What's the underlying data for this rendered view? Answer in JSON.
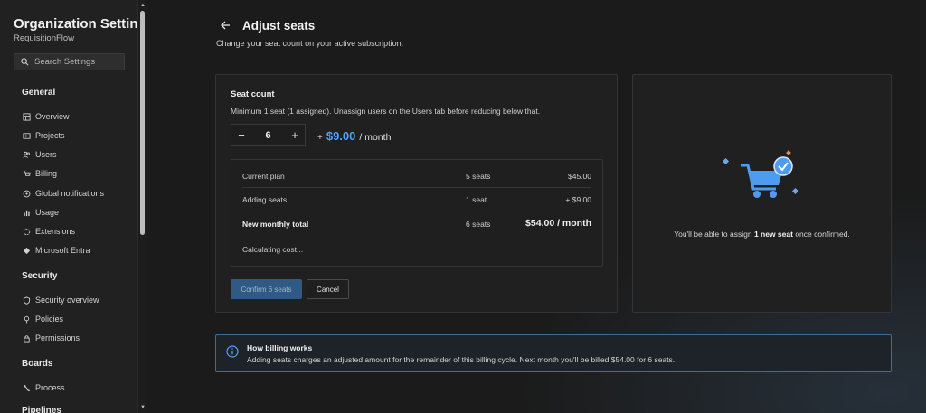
{
  "sidebar": {
    "title": "Organization Settin...",
    "org_name": "RequisitionFlow",
    "search_placeholder": "Search Settings",
    "groups": [
      {
        "label": "General",
        "items": [
          {
            "label": "Overview",
            "icon": "overview-icon"
          },
          {
            "label": "Projects",
            "icon": "projects-icon"
          },
          {
            "label": "Users",
            "icon": "users-icon"
          },
          {
            "label": "Billing",
            "icon": "billing-icon"
          },
          {
            "label": "Global notifications",
            "icon": "notifications-icon"
          },
          {
            "label": "Usage",
            "icon": "usage-icon"
          },
          {
            "label": "Extensions",
            "icon": "extensions-icon"
          },
          {
            "label": "Microsoft Entra",
            "icon": "entra-icon"
          }
        ]
      },
      {
        "label": "Security",
        "items": [
          {
            "label": "Security overview",
            "icon": "shield-icon"
          },
          {
            "label": "Policies",
            "icon": "policies-icon"
          },
          {
            "label": "Permissions",
            "icon": "lock-icon"
          }
        ]
      },
      {
        "label": "Boards",
        "items": [
          {
            "label": "Process",
            "icon": "process-icon"
          }
        ]
      },
      {
        "label": "Pipelines",
        "items": []
      }
    ]
  },
  "header": {
    "back_icon": "arrow-left-icon",
    "title": "Adjust seats",
    "subtitle": "Change your seat count on your active subscription."
  },
  "seat_card": {
    "title": "Seat count",
    "description": "Minimum 1 seat (1 assigned). Unassign users on the Users tab before reducing below that.",
    "decrement": "−",
    "value": "6",
    "increment": "+",
    "price_prefix": "+",
    "price": "$9.00",
    "price_period": "/ month",
    "summary": {
      "rows": [
        {
          "label": "Current plan",
          "seats": "5 seats",
          "amount": "$45.00"
        },
        {
          "label": "Adding seats",
          "seats": "1 seat",
          "amount": "+ $9.00"
        }
      ],
      "total": {
        "label": "New monthly total",
        "seats": "6 seats",
        "amount": "$54.00 / month"
      },
      "status": "Calculating cost..."
    },
    "confirm_label": "Confirm 6 seats",
    "cancel_label": "Cancel"
  },
  "illustration": {
    "icon": "shopping-cart-check-icon",
    "text_before": "You'll be able to assign ",
    "text_bold": "1 new seat",
    "text_after": " once confirmed."
  },
  "info": {
    "icon": "info-icon",
    "title": "How billing works",
    "body": "Adding seats charges an adjusted amount for the remainder of this billing cycle. Next month you'll be billed $54.00 for 6 seats."
  },
  "colors": {
    "accent": "#4da3ff",
    "confirm_button": "#2f5a84",
    "info_border": "#3d6d9b",
    "background": "#1b1b1b"
  }
}
